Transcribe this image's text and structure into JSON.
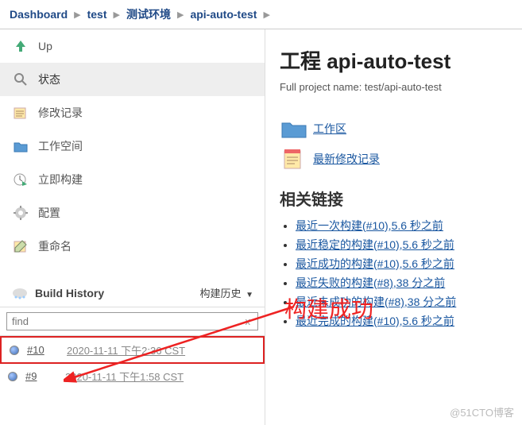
{
  "breadcrumbs": [
    "Dashboard",
    "test",
    "测试环境",
    "api-auto-test"
  ],
  "sidebar": {
    "items": [
      {
        "label": "Up"
      },
      {
        "label": "状态"
      },
      {
        "label": "修改记录"
      },
      {
        "label": "工作空间"
      },
      {
        "label": "立即构建"
      },
      {
        "label": "配置"
      },
      {
        "label": "重命名"
      }
    ]
  },
  "build_history": {
    "title": "Build History",
    "toggle": "构建历史",
    "find_placeholder": "find",
    "rows": [
      {
        "num": "#10",
        "ts": "2020-11-11 下午2:36 CST"
      },
      {
        "num": "#9",
        "ts": "2020-11-11 下午1:58 CST"
      }
    ]
  },
  "main": {
    "title": "工程 api-auto-test",
    "subtitle": "Full project name: test/api-auto-test",
    "actions": [
      {
        "label": "工作区"
      },
      {
        "label": "最新修改记录"
      }
    ],
    "section": "相关链接",
    "links": [
      "最近一次构建(#10),5.6 秒之前",
      "最近稳定的构建(#10),5.6 秒之前",
      "最近成功的构建(#10),5.6 秒之前",
      "最近失败的构建(#8),38 分之前",
      "最近未成功的构建(#8),38 分之前",
      "最近完成的构建(#10),5.6 秒之前"
    ]
  },
  "annotation": "构建成功",
  "watermark": "@51CTO博客"
}
